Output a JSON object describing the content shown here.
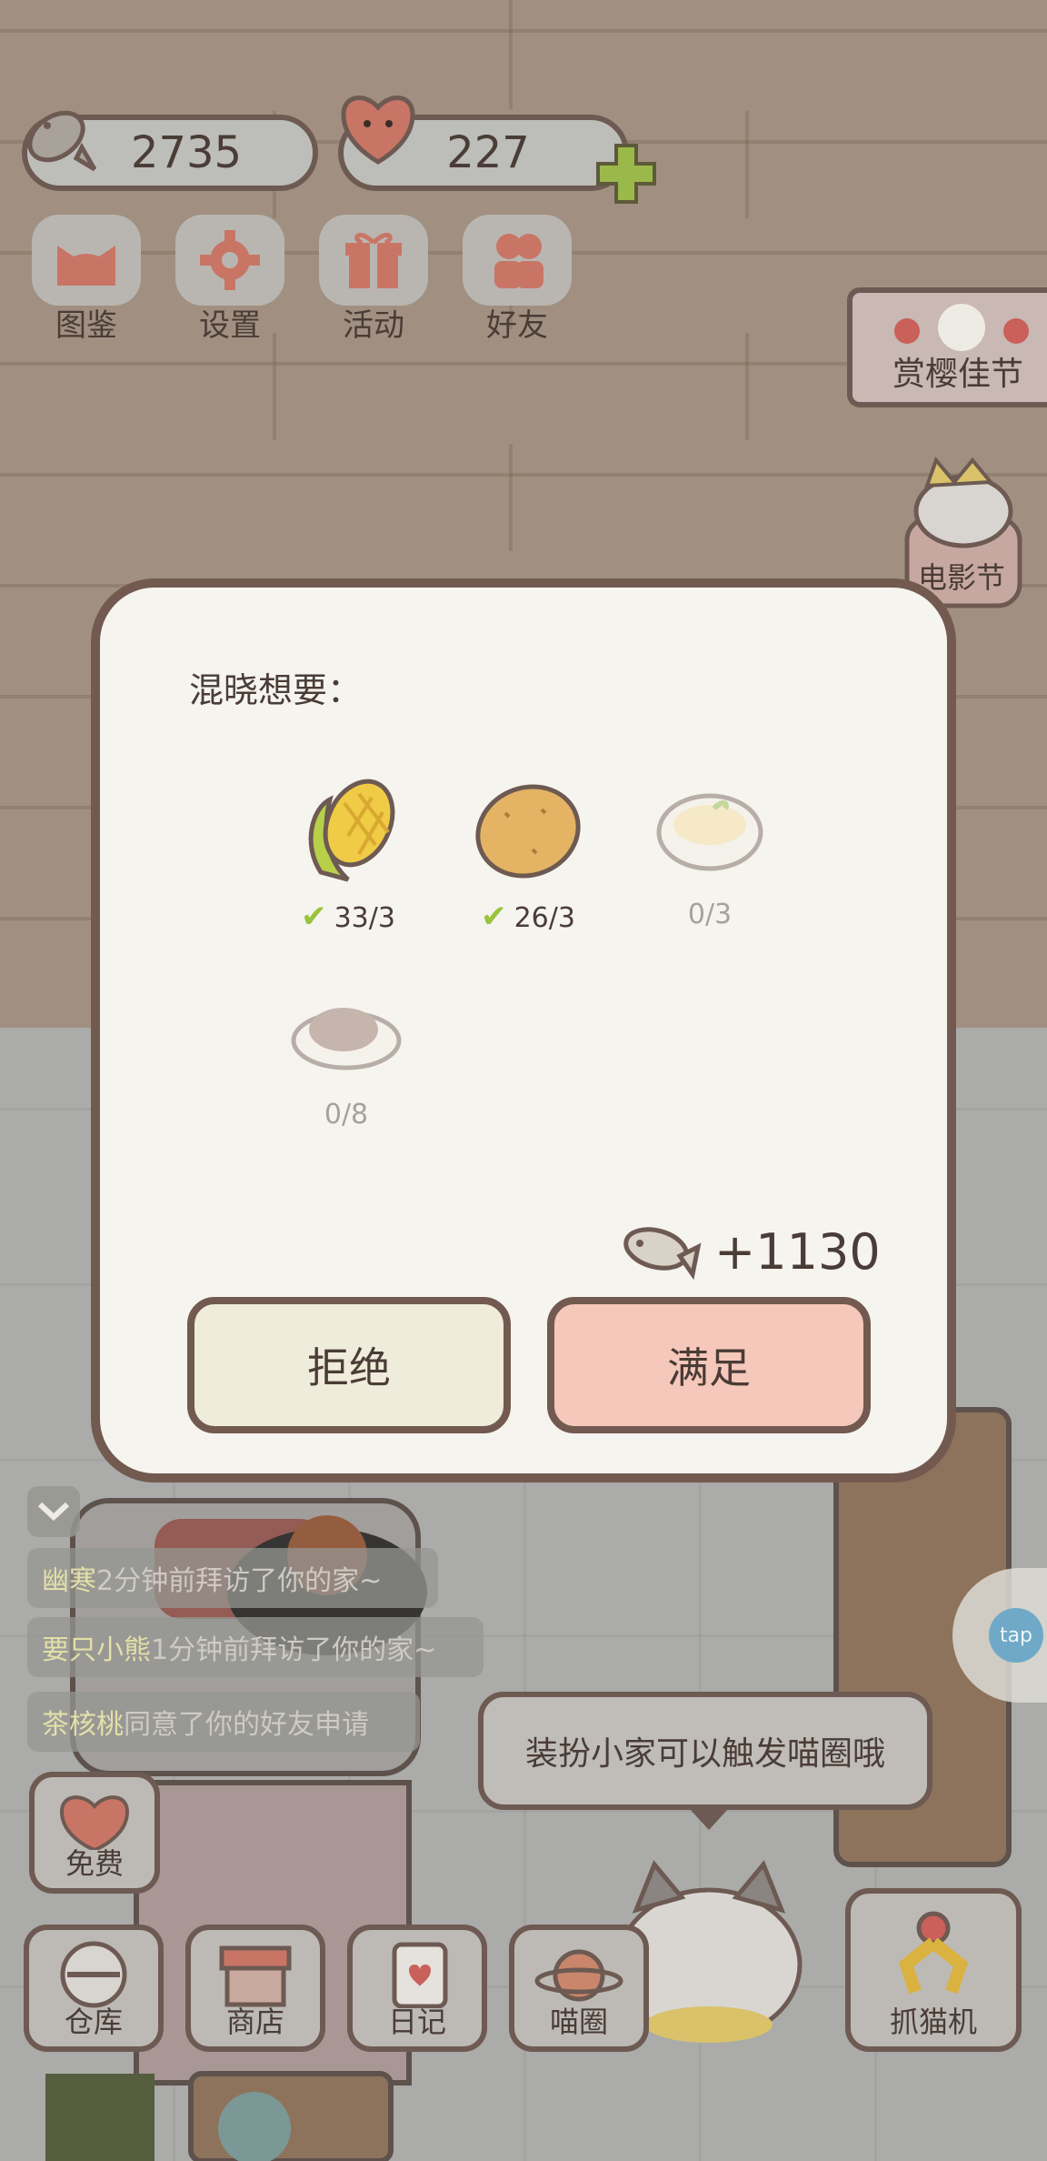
{
  "hud": {
    "fish_count": "2735",
    "heart_count": "227"
  },
  "menu": [
    {
      "label": "图鉴",
      "icon": "cat-head-icon"
    },
    {
      "label": "设置",
      "icon": "gear-icon"
    },
    {
      "label": "活动",
      "icon": "gift-icon"
    },
    {
      "label": "好友",
      "icon": "friends-icon"
    }
  ],
  "events": {
    "sakura_label": "赏樱佳节",
    "movie_label": "电影节"
  },
  "dialog": {
    "title": "混晓想要：",
    "items": [
      {
        "name": "corn",
        "count": "33/3",
        "done": true
      },
      {
        "name": "potato",
        "count": "26/3",
        "done": true
      },
      {
        "name": "mashed-potato-bowl",
        "count": "0/3",
        "done": false
      },
      {
        "name": "meat-dish",
        "count": "0/8",
        "done": false
      }
    ],
    "reward": "+1130",
    "reject_label": "拒绝",
    "accept_label": "满足"
  },
  "feed": [
    {
      "name": "幽寒",
      "text": "2分钟前拜访了你的家~"
    },
    {
      "name": "要只小熊",
      "text": "1分钟前拜访了你的家~"
    },
    {
      "name": "茶核桃",
      "text": "同意了你的好友申请"
    }
  ],
  "speech": "装扮小家可以触发喵圈哦",
  "bottom": {
    "free_label": "免费",
    "warehouse_label": "仓库",
    "shop_label": "商店",
    "diary_label": "日记",
    "circle_label": "喵圈",
    "claw_label": "抓猫机",
    "tap_label": "tap"
  },
  "colors": {
    "accept_btn": "#f6c8bb",
    "reject_btn": "#f0ecdb",
    "outline": "#725a50",
    "check": "#9ac23c"
  }
}
